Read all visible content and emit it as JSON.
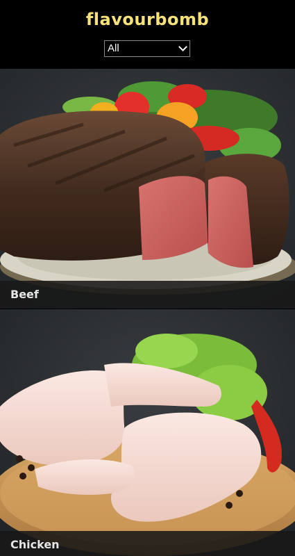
{
  "app": {
    "title": "flavourbomb"
  },
  "filter": {
    "selected": "All"
  },
  "categories": [
    {
      "label": "Beef"
    },
    {
      "label": "Chicken"
    }
  ],
  "colors": {
    "brand": "#f7e27a",
    "background": "#000000"
  }
}
